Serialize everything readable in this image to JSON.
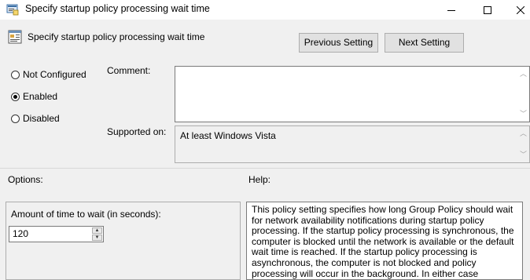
{
  "window": {
    "title": "Specify startup policy processing wait time",
    "controls": {
      "minimize": "—",
      "maximize": "☐",
      "close": "✕"
    }
  },
  "header": {
    "policy_title": "Specify startup policy processing wait time",
    "prev_button": "Previous Setting",
    "next_button": "Next Setting"
  },
  "state": {
    "options": [
      {
        "label": "Not Configured",
        "checked": false
      },
      {
        "label": "Enabled",
        "checked": true
      },
      {
        "label": "Disabled",
        "checked": false
      }
    ]
  },
  "comment": {
    "label": "Comment:",
    "value": ""
  },
  "supported": {
    "label": "Supported on:",
    "value": "At least Windows Vista"
  },
  "options_section": {
    "label": "Options:",
    "wait_label": "Amount of time to wait (in seconds):",
    "wait_value": "120"
  },
  "help_section": {
    "label": "Help:",
    "text": "This policy setting specifies how long Group Policy should wait for network availability notifications during startup policy processing. If the startup policy processing is synchronous, the computer is blocked until the network is available or the default wait time is reached. If the startup policy processing is asynchronous, the computer is not blocked and policy processing will occur in the background. In either case"
  }
}
